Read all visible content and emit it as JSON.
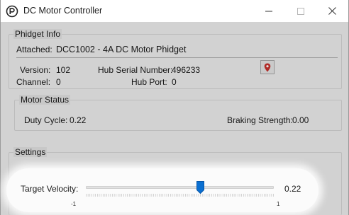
{
  "window": {
    "title": "DC Motor Controller",
    "icons": [
      "phidget-logo-icon",
      "minimize-icon",
      "maximize-icon",
      "close-icon"
    ]
  },
  "phidget_info": {
    "group_label": "Phidget Info",
    "attached_label": "Attached:",
    "attached_value": "DCC1002 - 4A DC Motor Phidget",
    "version_label": "Version:",
    "version_value": "102",
    "channel_label": "Channel:",
    "channel_value": "0",
    "hub_serial_label": "Hub Serial Number:",
    "hub_serial_value": "496233",
    "hub_port_label": "Hub Port:",
    "hub_port_value": "0",
    "locate_icon": "map-pin-icon",
    "locate_color": "#c9302c"
  },
  "motor_status": {
    "group_label": "Motor Status",
    "duty_cycle_label": "Duty Cycle:",
    "duty_cycle_value": "0.22",
    "braking_label": "Braking Strength:",
    "braking_value": "0.00"
  },
  "settings": {
    "group_label": "Settings",
    "target_velocity_label": "Target Velocity:",
    "target_velocity_value": "0.22",
    "slider_min_label": "-1",
    "slider_max_label": "1",
    "slider_min": -1,
    "slider_max": 1,
    "slider_value": 0.22,
    "thumb_color": "#0a6fd1"
  }
}
